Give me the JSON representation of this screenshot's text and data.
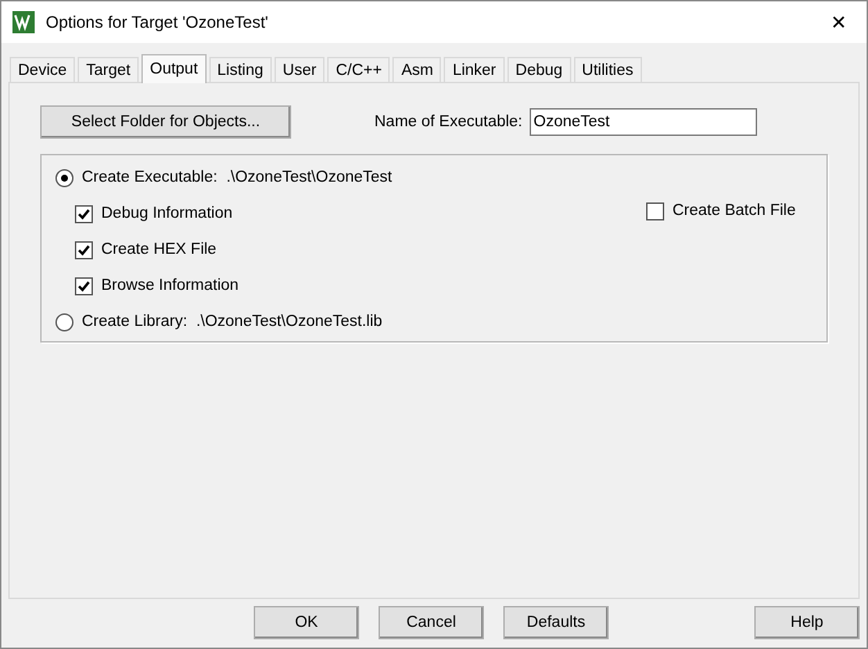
{
  "window": {
    "title": "Options for Target 'OzoneTest'",
    "close": "✕"
  },
  "tabs": [
    {
      "label": "Device",
      "selected": false
    },
    {
      "label": "Target",
      "selected": false
    },
    {
      "label": "Output",
      "selected": true
    },
    {
      "label": "Listing",
      "selected": false
    },
    {
      "label": "User",
      "selected": false
    },
    {
      "label": "C/C++",
      "selected": false
    },
    {
      "label": "Asm",
      "selected": false
    },
    {
      "label": "Linker",
      "selected": false
    },
    {
      "label": "Debug",
      "selected": false
    },
    {
      "label": "Utilities",
      "selected": false
    }
  ],
  "select_folder_button": "Select Folder for Objects...",
  "executable_name": {
    "label": "Name of Executable:",
    "value": "OzoneTest"
  },
  "output_mode": [
    {
      "label": "Create Executable:  .\\OzoneTest\\OzoneTest",
      "selected": true
    },
    {
      "label": "Create Library:  .\\OzoneTest\\OzoneTest.lib",
      "selected": false
    }
  ],
  "executable_options": [
    {
      "label": "Debug Information",
      "checked": true
    },
    {
      "label": "Create HEX File",
      "checked": true
    },
    {
      "label": "Browse Information",
      "checked": true
    }
  ],
  "create_batch_file": {
    "label": "Create Batch File",
    "checked": false
  },
  "buttons": [
    "OK",
    "Cancel",
    "Defaults"
  ],
  "help_button": "Help"
}
